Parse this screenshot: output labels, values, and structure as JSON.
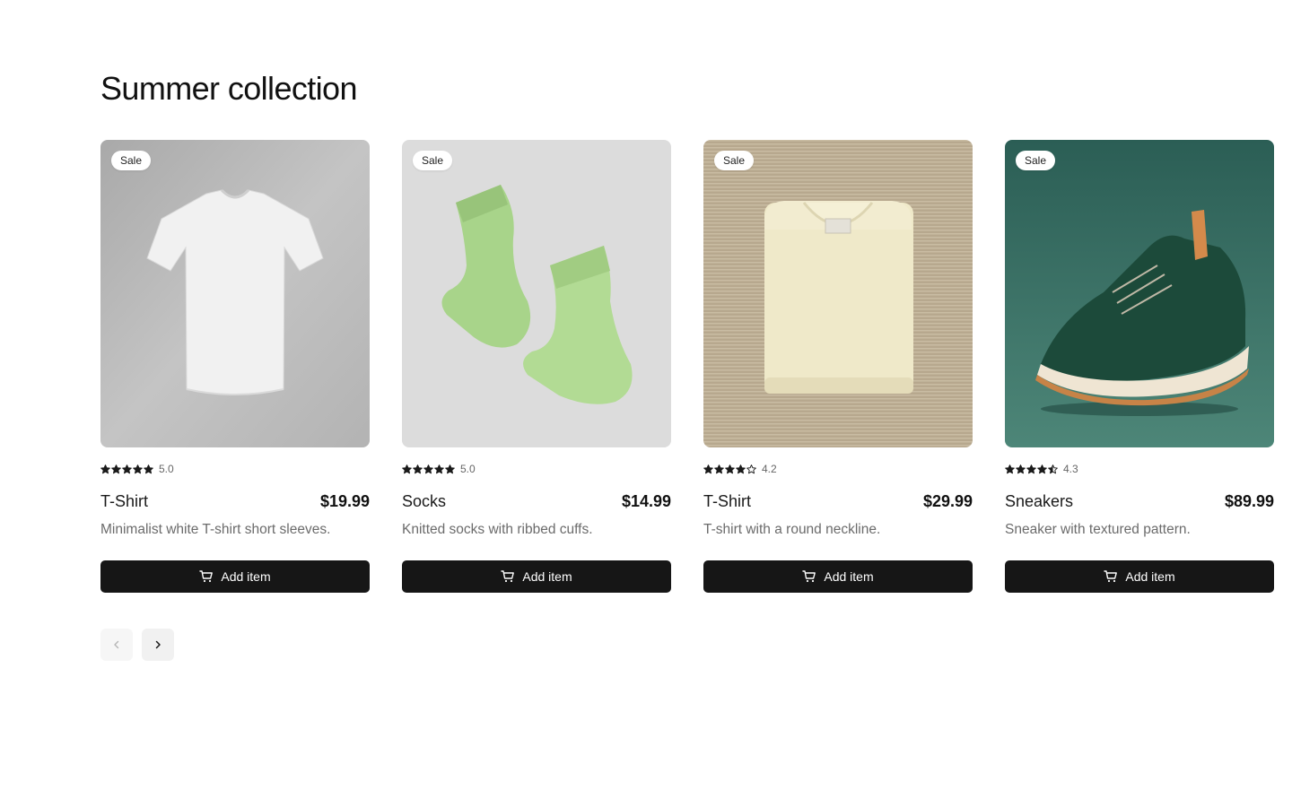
{
  "page": {
    "title": "Summer collection"
  },
  "products": [
    {
      "badge": "Sale",
      "rating": "5.0",
      "rating_value": 5.0,
      "name": "T-Shirt",
      "price": "$19.99",
      "description": "Minimalist white T-shirt short sleeves.",
      "button_label": "Add item",
      "image_icon": "white-tshirt-photo"
    },
    {
      "badge": "Sale",
      "rating": "5.0",
      "rating_value": 5.0,
      "name": "Socks",
      "price": "$14.99",
      "description": "Knitted socks with ribbed cuffs.",
      "button_label": "Add item",
      "image_icon": "green-socks-photo"
    },
    {
      "badge": "Sale",
      "rating": "4.2",
      "rating_value": 4.2,
      "name": "T-Shirt",
      "price": "$29.99",
      "description": "T-shirt with a round neckline.",
      "button_label": "Add item",
      "image_icon": "folded-cream-tshirt-photo"
    },
    {
      "badge": "Sale",
      "rating": "4.3",
      "rating_value": 4.3,
      "name": "Sneakers",
      "price": "$89.99",
      "description": "Sneaker with textured pattern.",
      "button_label": "Add item",
      "image_icon": "green-sneaker-photo"
    }
  ],
  "pagination": {
    "prev_icon": "chevron-left-icon",
    "next_icon": "chevron-right-icon",
    "prev_disabled": true
  },
  "colors": {
    "button_bg": "#161616",
    "text_primary": "#111111",
    "text_muted": "#6b6b6b",
    "star": "#1a1a1a"
  }
}
